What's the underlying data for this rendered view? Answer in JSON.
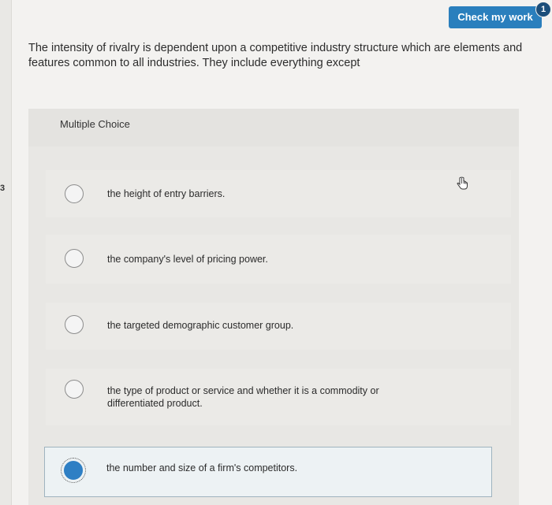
{
  "header": {
    "check_button_label": "Check my work",
    "badge_count": "1"
  },
  "sidebar": {
    "marker": "3"
  },
  "question": {
    "text": "The intensity of rivalry is dependent upon a competitive industry structure which are elements and features common to all industries. They include everything except"
  },
  "panel": {
    "type_label": "Multiple Choice",
    "options": [
      {
        "label": "the height of entry barriers.",
        "selected": false
      },
      {
        "label": "the company's level of pricing power.",
        "selected": false
      },
      {
        "label": "the targeted demographic customer group.",
        "selected": false
      },
      {
        "label": "the type of product or service and whether it is a commodity or differentiated product.",
        "selected": false
      },
      {
        "label": "the number and size of a firm's competitors.",
        "selected": true
      }
    ]
  },
  "colors": {
    "accent": "#2a7fbd",
    "badge": "#1c4e7a",
    "selected_radio": "#2e7fc4"
  },
  "icons": [
    "pointer-hand-icon"
  ]
}
